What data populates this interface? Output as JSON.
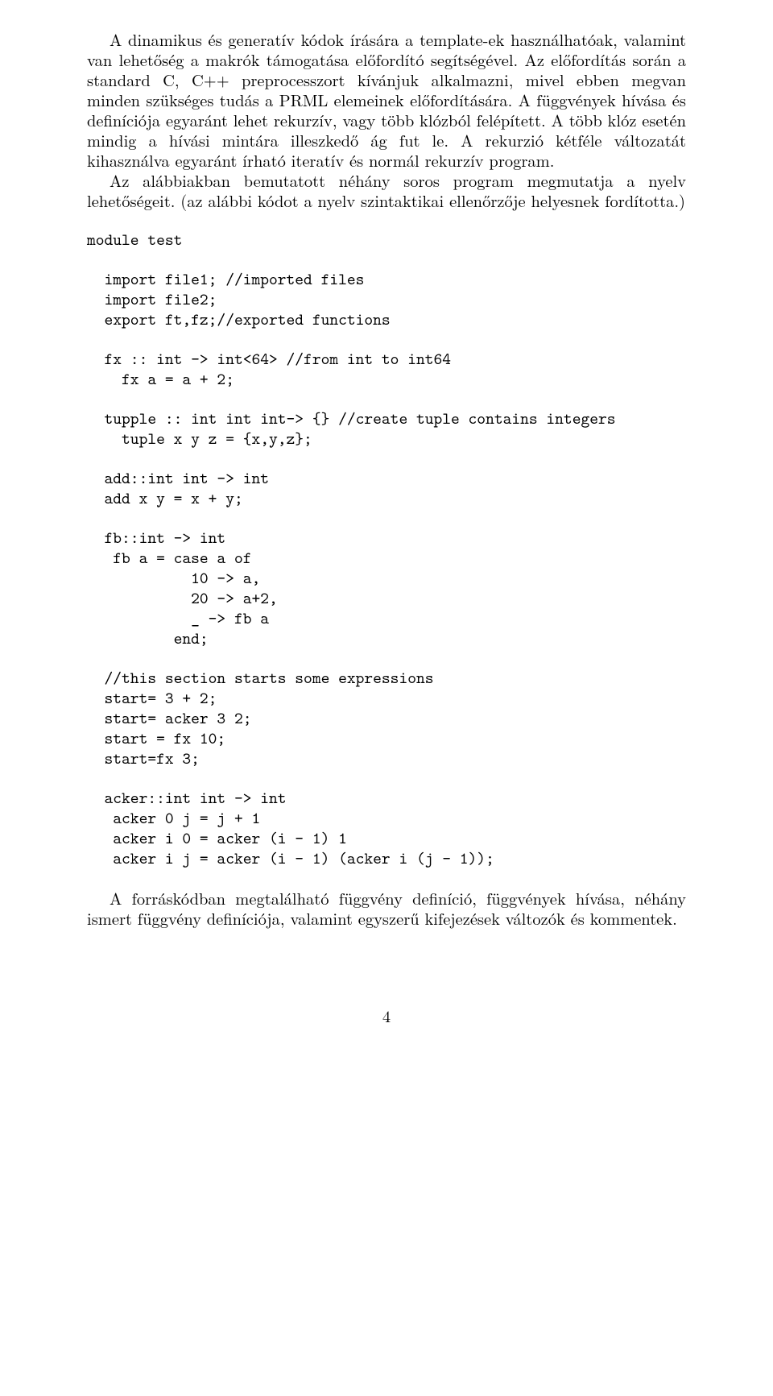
{
  "para1": "A dinamikus és generatív kódok írására a template-ek használhatóak, valamint van lehetőség a makrók támogatása előfordító segítségével. Az előfordítás során a standard C, C++ preprocesszort kívánjuk alkalmazni, mivel ebben megvan minden szükséges tudás a PRML elemeinek előfordítására. A függvények hívása és definíciója egyaránt lehet rekurzív, vagy több klózból felépített. A több klóz esetén mindig a hívási mintára illeszkedő ág fut le. A rekurzió kétféle változatát kihasználva egyaránt írható iteratív és normál rekurzív program.",
  "para2": "Az alábbiakban bemutatott néhány soros program megmutatja a nyelv lehetőségeit. (az alábbi kódot a nyelv szintaktikai ellenőrzője helyesnek fordította.)",
  "code1": "module test",
  "code2": "  import file1; //imported files\n  import file2;\n  export ft,fz;//exported functions",
  "code3": "  fx :: int -> int<64> //from int to int64\n    fx a = a + 2;",
  "code4": "  tupple :: int int int-> {} //create tuple contains integers\n    tuple x y z = {x,y,z};",
  "code5": "  add::int int -> int\n  add x y = x + y;",
  "code6": "  fb::int -> int\n   fb a = case a of\n            10 -> a,\n            20 -> a+2,\n            _ -> fb a\n          end;",
  "code7": "  //this section starts some expressions\n  start= 3 + 2;\n  start= acker 3 2;\n  start = fx 10;\n  start=fx 3;",
  "code8": "  acker::int int -> int\n   acker 0 j = j + 1\n   acker i 0 = acker (i - 1) 1\n   acker i j = acker (i - 1) (acker i (j - 1));",
  "para3": "A forráskódban megtalálható függvény definíció, függvények hívása, néhány ismert függvény definíciója, valamint egyszerű kifejezések változók és kommentek.",
  "pagenum": "4"
}
